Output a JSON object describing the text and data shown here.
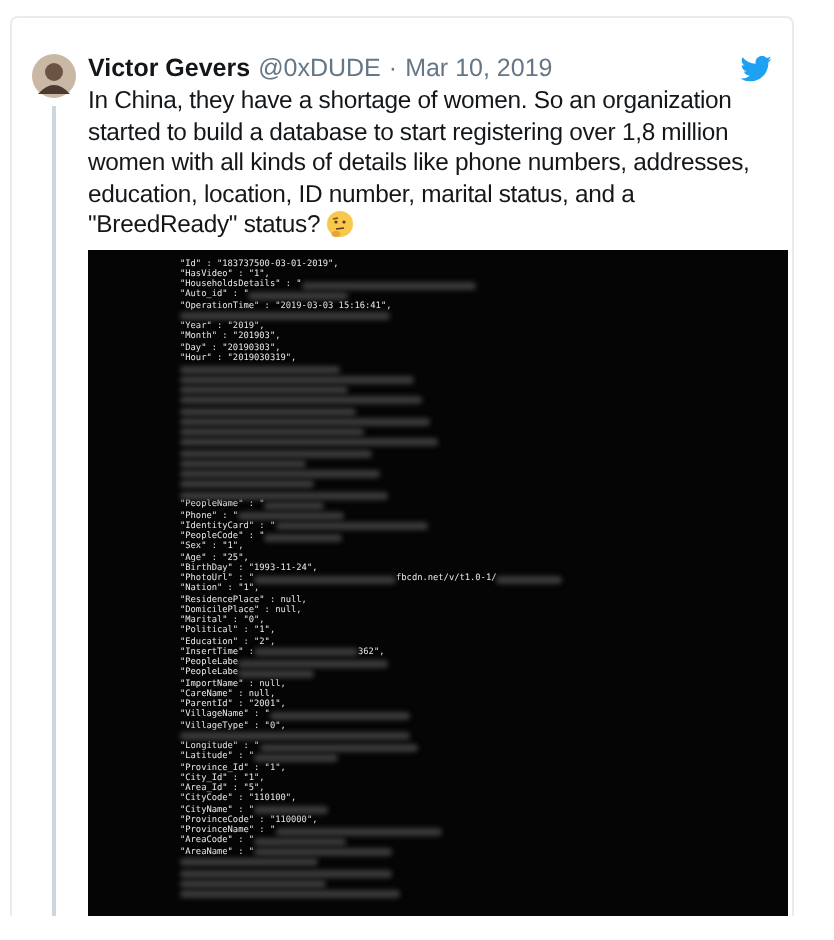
{
  "tweet": {
    "author": "Victor Gevers",
    "handle": "@0xDUDE",
    "separator": "·",
    "date": "Mar 10, 2019",
    "text": "In China, they have a shortage of women. So an organization started to build a database to start registering over 1,8 million women with all kinds of details like phone numbers, addresses, education,  location, ID number, marital status, and a \"BreedReady\" status?"
  },
  "terminal": {
    "lines": [
      [
        {
          "kind": "text",
          "text": "\"Id\" : \"183737500-03-01-2019\","
        }
      ],
      [
        {
          "kind": "text",
          "text": "\"HasVideo\" : \"1\","
        }
      ],
      [
        {
          "kind": "text",
          "text": "\"HouseholdsDetails\" : \""
        },
        {
          "kind": "redacted"
        }
      ],
      [
        {
          "kind": "text",
          "text": "\"Auto_id\" : \""
        },
        {
          "kind": "redacted"
        }
      ],
      [
        {
          "kind": "text",
          "text": "\"OperationTime\" : \"2019-03-03 15:16:41\","
        }
      ],
      [
        {
          "kind": "redacted"
        }
      ],
      [
        {
          "kind": "text",
          "text": "\"Year\" : \"2019\","
        }
      ],
      [
        {
          "kind": "text",
          "text": "\"Month\" : \"201903\","
        }
      ],
      [
        {
          "kind": "text",
          "text": "\"Day\" : \"20190303\","
        }
      ],
      [
        {
          "kind": "text",
          "text": "\"Hour\" : \"2019030319\","
        }
      ],
      [
        {
          "kind": "redacted"
        }
      ],
      [
        {
          "kind": "redacted"
        }
      ],
      [
        {
          "kind": "redacted"
        }
      ],
      [
        {
          "kind": "redacted"
        }
      ],
      [
        {
          "kind": "redacted"
        }
      ],
      [
        {
          "kind": "redacted"
        }
      ],
      [
        {
          "kind": "redacted"
        }
      ],
      [
        {
          "kind": "redacted"
        }
      ],
      [
        {
          "kind": "redacted"
        }
      ],
      [
        {
          "kind": "redacted"
        }
      ],
      [
        {
          "kind": "redacted"
        }
      ],
      [
        {
          "kind": "redacted"
        }
      ],
      [
        {
          "kind": "redacted"
        }
      ],
      [
        {
          "kind": "text",
          "text": "\"PeopleName\" : \""
        },
        {
          "kind": "redacted"
        }
      ],
      [
        {
          "kind": "text",
          "text": "\"Phone\" : \""
        },
        {
          "kind": "redacted"
        }
      ],
      [
        {
          "kind": "text",
          "text": "\"IdentityCard\" : \""
        },
        {
          "kind": "redacted"
        }
      ],
      [
        {
          "kind": "text",
          "text": "\"PeopleCode\" : \""
        },
        {
          "kind": "redacted"
        }
      ],
      [
        {
          "kind": "text",
          "text": "\"Sex\" : \"1\","
        }
      ],
      [
        {
          "kind": "text",
          "text": "\"Age\" : \"25\","
        }
      ],
      [
        {
          "kind": "text",
          "text": "\"BirthDay\" : \"1993-11-24\","
        }
      ],
      [
        {
          "kind": "text",
          "text": "\"PhotoUrl\" : \""
        },
        {
          "kind": "redacted"
        },
        {
          "kind": "text",
          "text": "fbcdn.net/v/t1.0-1/"
        },
        {
          "kind": "redacted"
        }
      ],
      [
        {
          "kind": "text",
          "text": "\"Nation\" : \"1\","
        }
      ],
      [
        {
          "kind": "text",
          "text": "\"ResidencePlace\" : null,"
        }
      ],
      [
        {
          "kind": "text",
          "text": "\"DomicilePlace\" : null,"
        }
      ],
      [
        {
          "kind": "text",
          "text": "\"Marital\" : \"0\","
        }
      ],
      [
        {
          "kind": "text",
          "text": "\"Political\" : \"1\","
        }
      ],
      [
        {
          "kind": "text",
          "text": "\"Education\" : \"2\","
        }
      ],
      [
        {
          "kind": "text",
          "text": "\"InsertTime\" : "
        },
        {
          "kind": "redacted"
        },
        {
          "kind": "text",
          "text": "362\","
        }
      ],
      [
        {
          "kind": "text",
          "text": "\"PeopleLabe"
        },
        {
          "kind": "redacted"
        }
      ],
      [
        {
          "kind": "text",
          "text": "\"PeopleLabe"
        },
        {
          "kind": "redacted"
        }
      ],
      [
        {
          "kind": "text",
          "text": "\"ImportName\" : null,"
        }
      ],
      [
        {
          "kind": "text",
          "text": "\"CareName\" : null,"
        }
      ],
      [
        {
          "kind": "text",
          "text": "\"ParentId\" : \"2001\","
        }
      ],
      [
        {
          "kind": "text",
          "text": "\"VillageName\" : \""
        },
        {
          "kind": "redacted"
        }
      ],
      [
        {
          "kind": "text",
          "text": "\"VillageType\" : \"0\","
        }
      ],
      [
        {
          "kind": "redacted"
        }
      ],
      [
        {
          "kind": "text",
          "text": "\"Longitude\" : \""
        },
        {
          "kind": "redacted"
        }
      ],
      [
        {
          "kind": "text",
          "text": "\"Latitude\" : \""
        },
        {
          "kind": "redacted"
        }
      ],
      [
        {
          "kind": "text",
          "text": "\"Province_Id\" : \"1\","
        }
      ],
      [
        {
          "kind": "text",
          "text": "\"City_Id\" : \"1\","
        }
      ],
      [
        {
          "kind": "text",
          "text": "\"Area_Id\" : \"5\","
        }
      ],
      [
        {
          "kind": "text",
          "text": "\"CityCode\" : \"110100\","
        }
      ],
      [
        {
          "kind": "text",
          "text": "\"CityName\" : \""
        },
        {
          "kind": "redacted"
        }
      ],
      [
        {
          "kind": "text",
          "text": "\"ProvinceCode\" : \"110000\","
        }
      ],
      [
        {
          "kind": "text",
          "text": "\"ProvinceName\" : \""
        },
        {
          "kind": "redacted"
        }
      ],
      [
        {
          "kind": "text",
          "text": "\"AreaCode\" : \""
        },
        {
          "kind": "redacted"
        }
      ],
      [
        {
          "kind": "text",
          "text": "\"AreaName\" : \""
        },
        {
          "kind": "redacted"
        }
      ],
      [
        {
          "kind": "redacted"
        }
      ],
      [
        {
          "kind": "redacted"
        }
      ],
      [
        {
          "kind": "redacted"
        }
      ],
      [
        {
          "kind": "redacted"
        }
      ]
    ]
  }
}
